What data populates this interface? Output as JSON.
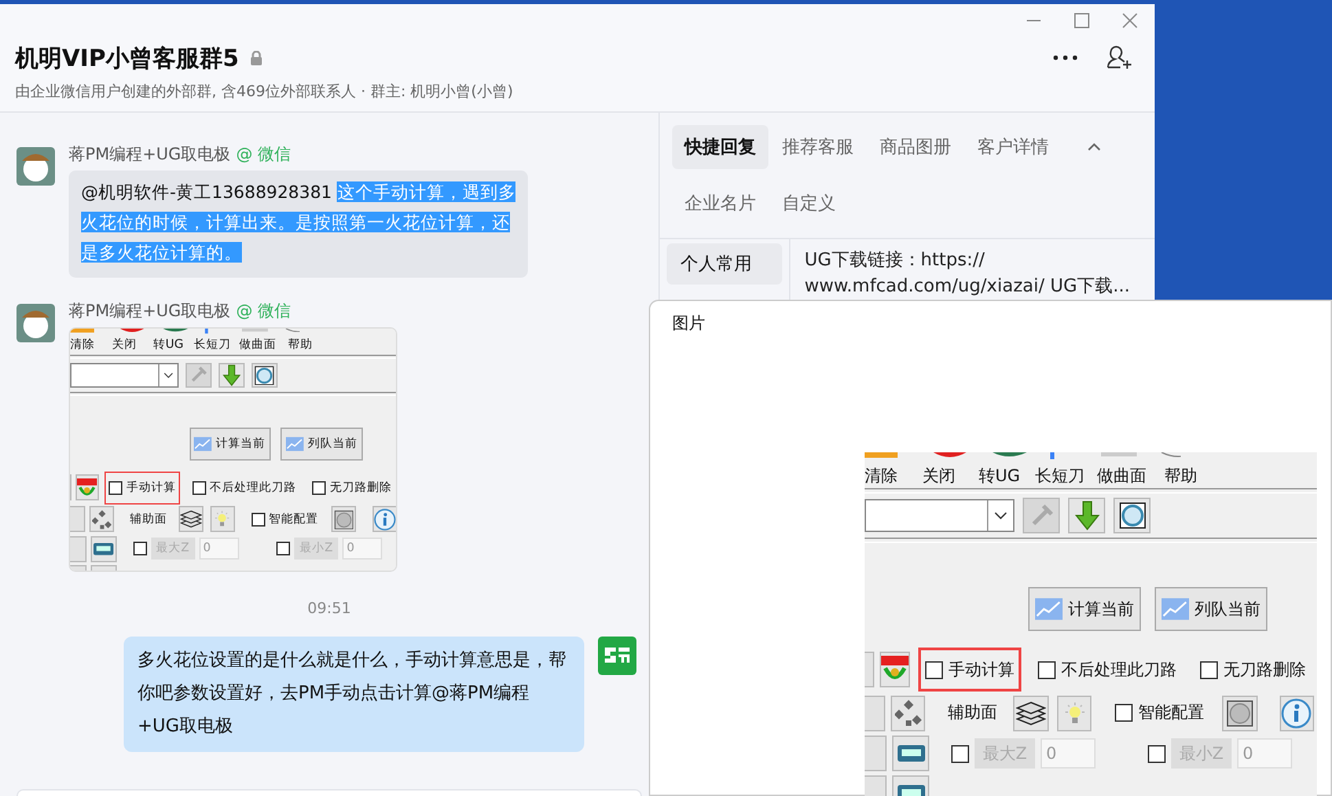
{
  "window": {
    "title": "机明VIP小曾客服群5",
    "locked": true,
    "subtitle": "由企业微信用户创建的外部群, 含469位外部联系人 · 群主: 机明小曾(小曾)"
  },
  "messages": [
    {
      "kind": "text",
      "sender": "蒋PM编程+UG取电极",
      "source": "@ 微信",
      "segments": [
        {
          "text": "@机明软件-黄工13688928381 ",
          "selected": false
        },
        {
          "text": "这个手动计算，遇到多火花位的时候，计算出来。是按照第一火花位计算，还是多火花位计算的。",
          "selected": true
        }
      ]
    },
    {
      "kind": "image",
      "sender": "蒋PM编程+UG取电极",
      "source": "@ 微信",
      "screenshot": {
        "toolbar": [
          "清除",
          "关闭",
          "转UG",
          "长短刀",
          "做曲面",
          "帮助"
        ],
        "action_buttons": [
          "计算当前",
          "列队当前"
        ],
        "checkboxes": [
          {
            "label": "手动计算",
            "checked": false,
            "highlighted": true
          },
          {
            "label": "不后处理此刀路",
            "checked": false,
            "highlighted": false
          },
          {
            "label": "无刀路删除",
            "checked": false,
            "highlighted": false
          }
        ],
        "aux_label": "辅助面",
        "smart_option": {
          "label": "智能配置",
          "checked": false
        },
        "z_fields": [
          {
            "label": "最大Z",
            "value": "0",
            "checked": false
          },
          {
            "label": "最小Z",
            "value": "0",
            "checked": false
          }
        ]
      }
    },
    {
      "kind": "time",
      "text": "09:51"
    },
    {
      "kind": "own",
      "text": "多火花位设置的是什么就是什么，手动计算意思是，帮你吧参数设置好，去PM手动点击计算@蒋PM编程+UG取电极"
    }
  ],
  "side_panel": {
    "tabs": [
      {
        "label": "快捷回复",
        "selected": true
      },
      {
        "label": "推荐客服",
        "selected": false
      },
      {
        "label": "商品图册",
        "selected": false
      },
      {
        "label": "客户详情",
        "selected": false
      },
      {
        "label": "企业名片",
        "selected": false
      },
      {
        "label": "自定义",
        "selected": false
      }
    ],
    "categories": [
      {
        "label": "个人常用",
        "selected": true
      }
    ],
    "replies": [
      "UG下载链接：https:// www.mfcad.com/ug/xiazai/ UG下载..."
    ]
  },
  "image_viewer": {
    "title": "图片",
    "screenshot": {
      "toolbar": [
        "清除",
        "关闭",
        "转UG",
        "长短刀",
        "做曲面",
        "帮助"
      ],
      "action_buttons": [
        "计算当前",
        "列队当前"
      ],
      "checkboxes": [
        {
          "label": "手动计算",
          "checked": false,
          "highlighted": true
        },
        {
          "label": "不后处理此刀路",
          "checked": false,
          "highlighted": false
        },
        {
          "label": "无刀路删除",
          "checked": false,
          "highlighted": false
        }
      ],
      "aux_label": "辅助面",
      "smart_option": {
        "label": "智能配置",
        "checked": false
      },
      "z_fields": [
        {
          "label": "最大Z",
          "value": "0",
          "checked": false
        },
        {
          "label": "最小Z",
          "value": "0",
          "checked": false
        }
      ]
    }
  }
}
